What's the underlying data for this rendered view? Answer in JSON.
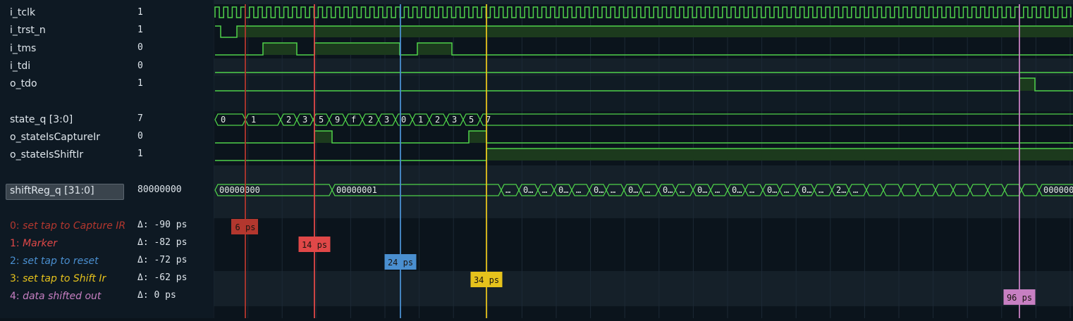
{
  "signals": [
    {
      "name": "i_tclk",
      "value": "1"
    },
    {
      "name": "i_trst_n",
      "value": "1"
    },
    {
      "name": "i_tms",
      "value": "0"
    },
    {
      "name": "i_tdi",
      "value": "0"
    },
    {
      "name": "o_tdo",
      "value": "1"
    },
    {
      "name": "state_q [3:0]",
      "value": "7"
    },
    {
      "name": "o_stateIsCaptureIr",
      "value": "0"
    },
    {
      "name": "o_stateIsShiftIr",
      "value": "1"
    },
    {
      "name": "shiftReg_q [31:0]",
      "value": "80000000",
      "selected": true
    }
  ],
  "markers": [
    {
      "index": "0:",
      "label": "set tap to Capture IR",
      "delta": "Δ: -90 ps",
      "time_label": "6 ps",
      "time": 6,
      "color": "#b3372e"
    },
    {
      "index": "1:",
      "label": "Marker",
      "delta": "Δ: -82 ps",
      "time_label": "14 ps",
      "time": 14,
      "color": "#e04848"
    },
    {
      "index": "2:",
      "label": "set tap to reset",
      "delta": "Δ: -72 ps",
      "time_label": "24 ps",
      "time": 24,
      "color": "#4a8fd0"
    },
    {
      "index": "3:",
      "label": "set tap to Shift Ir",
      "delta": "Δ: -62 ps",
      "time_label": "34 ps",
      "time": 34,
      "color": "#e6c21c"
    },
    {
      "index": "4:",
      "label": "data shifted out",
      "delta": "Δ: 0 ps",
      "time_label": "96 ps",
      "time": 96,
      "color": "#c77fc2"
    }
  ],
  "waveforms": {
    "state_q_segments": [
      "0",
      "1",
      "2",
      "3",
      "5",
      "9",
      "f",
      "2",
      "3",
      "0",
      "1",
      "2",
      "3",
      "5",
      "7"
    ],
    "shiftReg_segments": [
      "00000000",
      "00000001",
      "…",
      "0…",
      "…",
      "0…",
      "…",
      "0…",
      "…",
      "0…",
      "…",
      "0…",
      "…",
      "0…",
      "…",
      "0…",
      "…",
      "0…",
      "…",
      "0…",
      "…",
      "2…",
      "…",
      "0000000"
    ]
  },
  "colors": {
    "wave": "#4fd14a",
    "wave_fill": "#1c3a1d",
    "background": "#0b141c",
    "panel": "#0e1923"
  }
}
